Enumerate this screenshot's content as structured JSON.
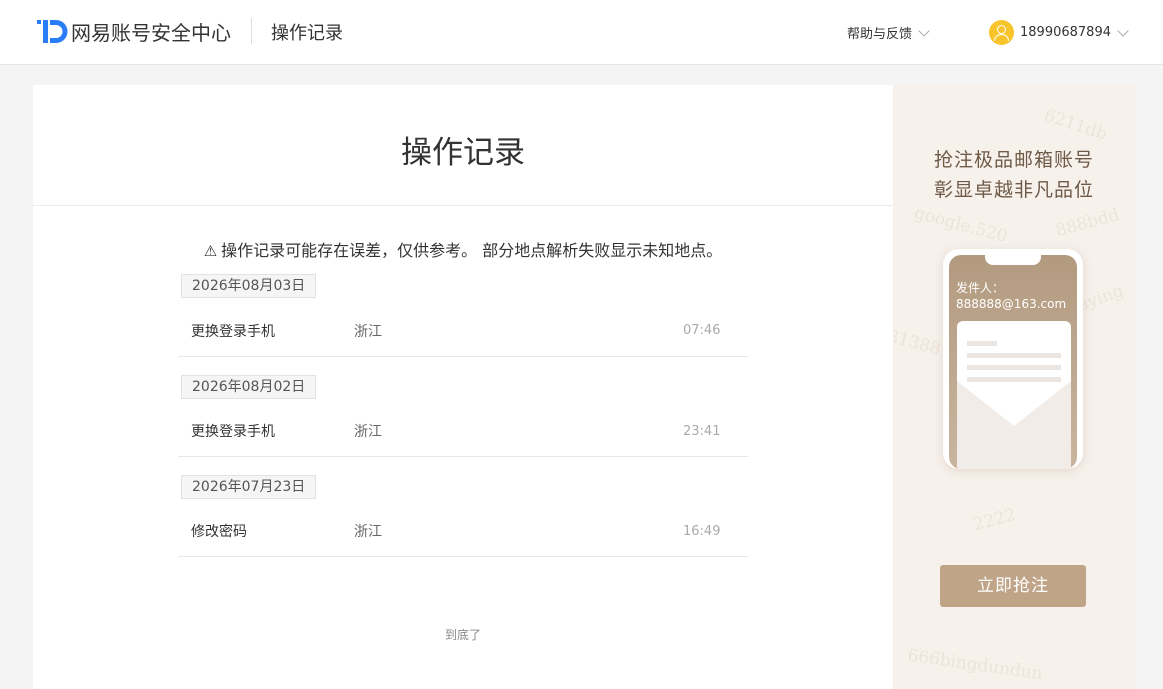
{
  "header": {
    "brand": "网易账号安全中心",
    "page_name": "操作记录",
    "help_label": "帮助与反馈",
    "user_phone": "18990687894"
  },
  "main": {
    "title": "操作记录",
    "notice": "操作记录可能存在误差，仅供参考。 部分地点解析失败显示未知地点。",
    "records": [
      {
        "date": "2026年08月03日",
        "action": "更换登录手机",
        "location": "浙江",
        "time": "07:46"
      },
      {
        "date": "2026年08月02日",
        "action": "更换登录手机",
        "location": "浙江",
        "time": "23:41"
      },
      {
        "date": "2026年07月23日",
        "action": "修改密码",
        "location": "浙江",
        "time": "16:49"
      }
    ],
    "end_text": "到底了"
  },
  "ad": {
    "title_line1": "抢注极品邮箱账号",
    "title_line2": "彰显卓越非凡品位",
    "sender_label": "发件人：",
    "sender_email": "888888@163.com",
    "button_label": "立即抢注",
    "watermarks": [
      "6211db",
      "888bdd",
      "google.520",
      "31388",
      "2222",
      "666bingdundun",
      "jiaying"
    ]
  },
  "colors": {
    "brand_blue": "#2a7df6",
    "avatar_yellow": "#f8c42c",
    "ad_button": "#c0a488",
    "ad_background": "#f7f1ec"
  }
}
